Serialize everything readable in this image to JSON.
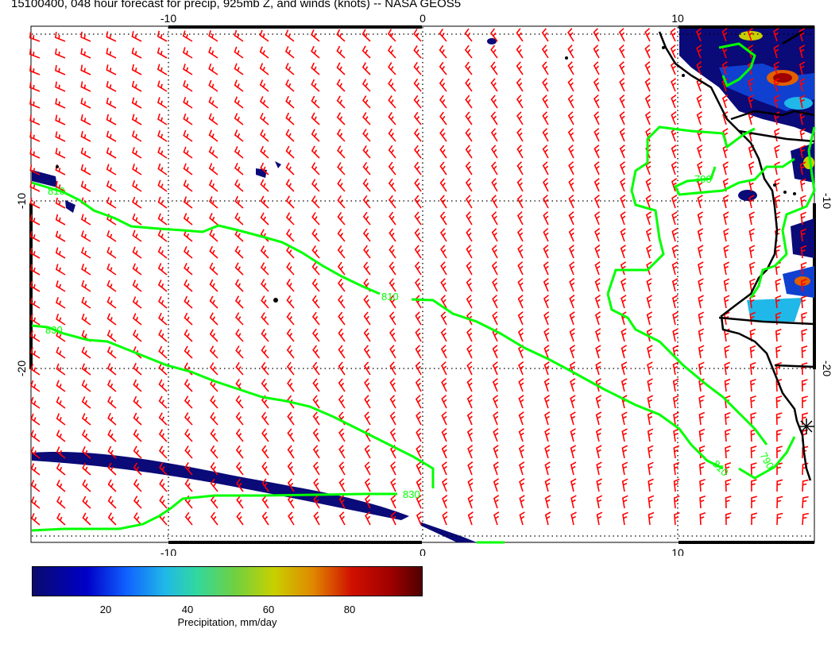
{
  "title": "15100400, 048 hour forecast for precip, 925mb Z, and winds (knots) -- NASA GEOS5",
  "axes": {
    "x_ticks": [
      "-10",
      "0",
      "10"
    ],
    "y_ticks": [
      "-10",
      "-20"
    ]
  },
  "contours": {
    "labels": [
      "810",
      "810",
      "830",
      "830",
      "790",
      "790",
      "810",
      "810"
    ],
    "color": "#00ff00"
  },
  "wind_barb_color": "#ff0000",
  "colorbar": {
    "ticks": [
      "20",
      "40",
      "60",
      "80"
    ],
    "label": "Precipitation, mm/day"
  },
  "chart_data": {
    "type": "heatmap",
    "title": "15100400, 048 hour forecast for precip, 925mb Z, and winds (knots) -- NASA GEOS5",
    "x_ticks": [
      -10,
      0,
      10
    ],
    "y_ticks": [
      -10,
      -20
    ],
    "colorbar_ticks": [
      20,
      40,
      60,
      80
    ],
    "colorbar_label": "Precipitation, mm/day",
    "contour_levels": [
      790,
      810,
      830
    ],
    "grid": true
  }
}
